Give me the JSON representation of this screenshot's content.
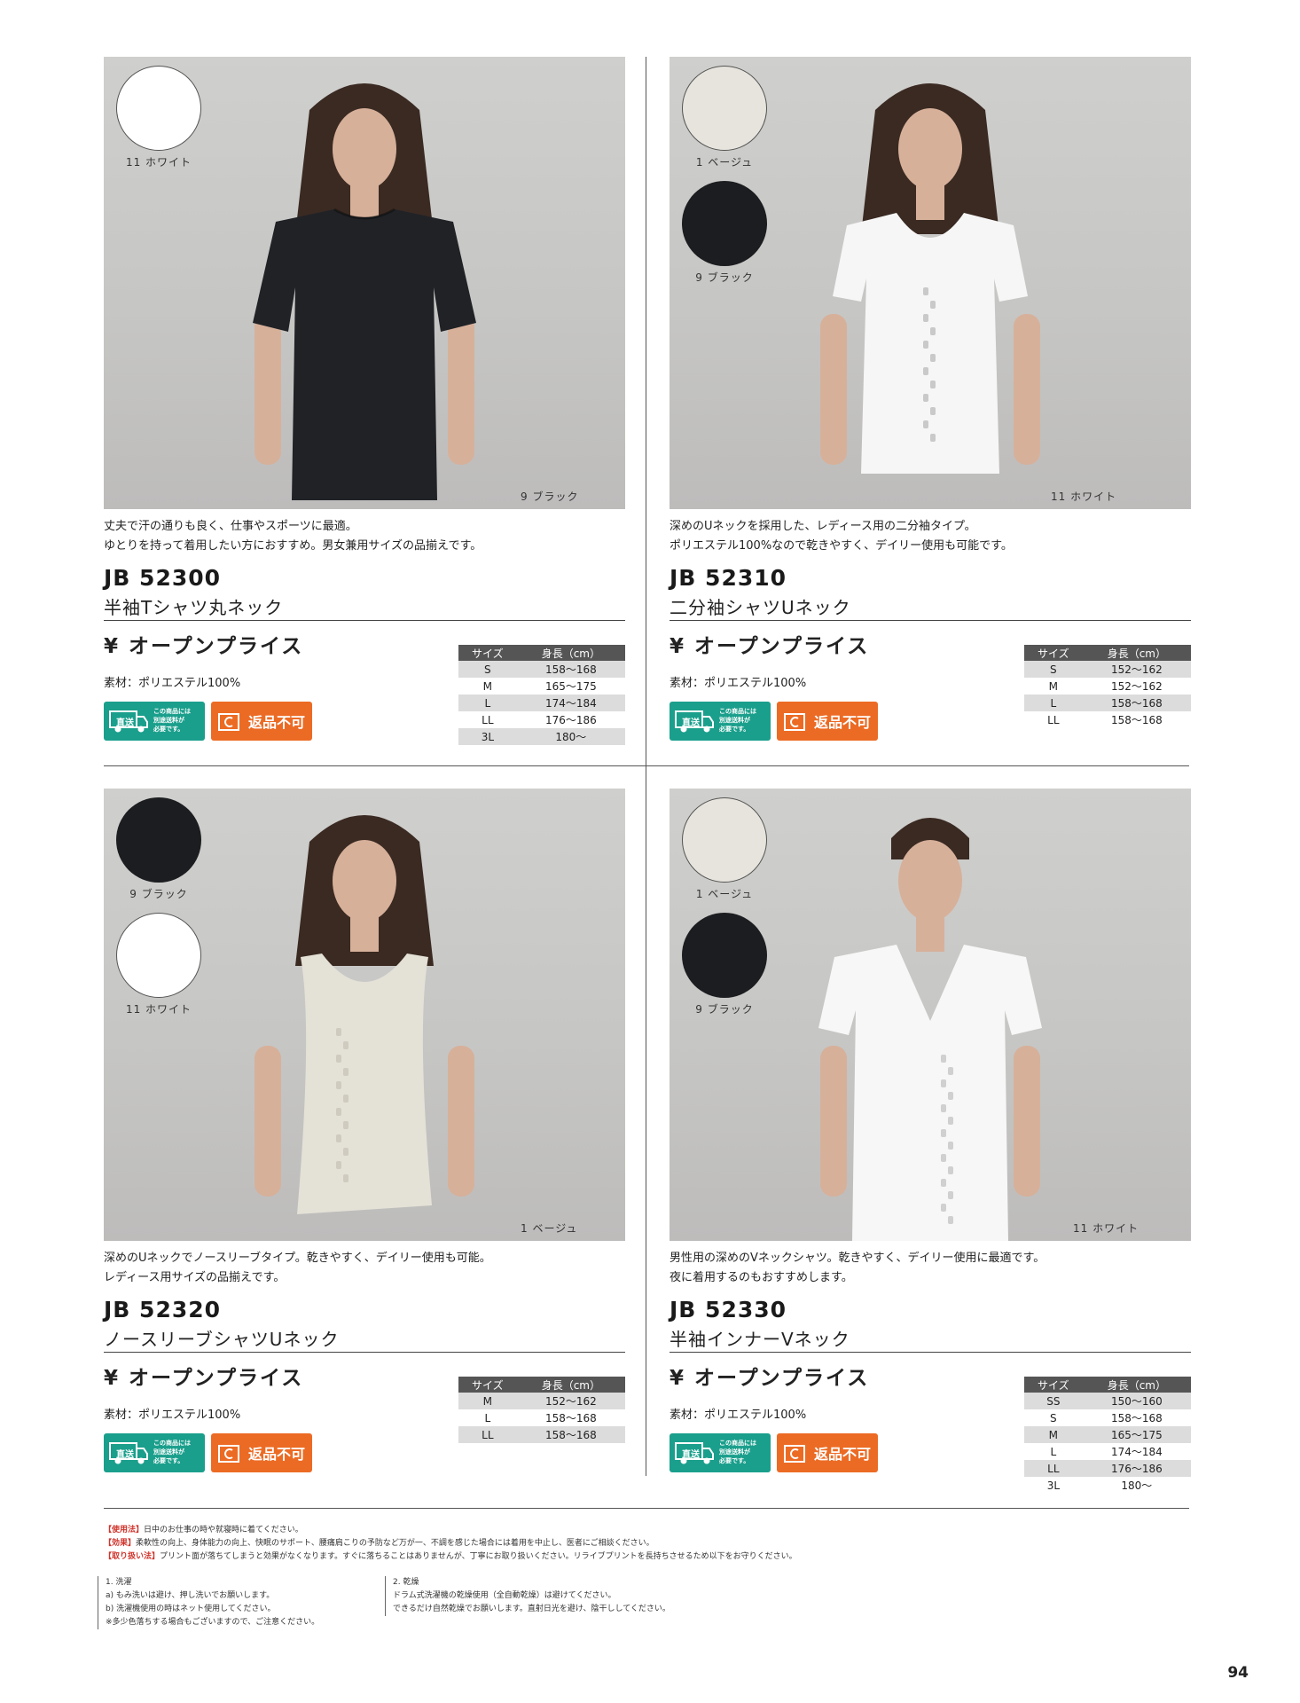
{
  "products": [
    {
      "photo_caption": "9 ブラック",
      "swatches": [
        {
          "label": "11 ホワイト",
          "color": "white"
        }
      ],
      "garment_color": "#202226",
      "garment_style": "tee",
      "desc": [
        "丈夫で汗の通りも良く、仕事やスポーツに最適。",
        "ゆとりを持って着用したい方におすすめ。男女兼用サイズの品揃えです。"
      ],
      "code": "JB 52300",
      "name": "半袖Tシャツ丸ネック",
      "price": "¥ オープンプライス",
      "material": "素材：ポリエステル100%",
      "size_header": [
        "サイズ",
        "身長（cm）"
      ],
      "sizes": [
        [
          "S",
          "158〜168"
        ],
        [
          "M",
          "165〜175"
        ],
        [
          "L",
          "174〜184"
        ],
        [
          "LL",
          "176〜186"
        ],
        [
          "3L",
          "180〜"
        ]
      ]
    },
    {
      "photo_caption": "11 ホワイト",
      "swatches": [
        {
          "label": "1 ベージュ",
          "color": "beige"
        },
        {
          "label": "9 ブラック",
          "color": "black"
        }
      ],
      "garment_color": "#f6f6f6",
      "garment_style": "ladies",
      "desc": [
        "深めのUネックを採用した、レディース用の二分袖タイプ。",
        "ポリエステル100%なので乾きやすく、デイリー使用も可能です。"
      ],
      "code": "JB 52310",
      "name": "二分袖シャツUネック",
      "price": "¥ オープンプライス",
      "material": "素材：ポリエステル100%",
      "size_header": [
        "サイズ",
        "身長（cm）"
      ],
      "sizes": [
        [
          "S",
          "152〜162"
        ],
        [
          "M",
          "152〜162"
        ],
        [
          "L",
          "158〜168"
        ],
        [
          "LL",
          "158〜168"
        ]
      ]
    },
    {
      "photo_caption": "1 ベージュ",
      "swatches": [
        {
          "label": "9 ブラック",
          "color": "black"
        },
        {
          "label": "11 ホワイト",
          "color": "white"
        }
      ],
      "garment_color": "#e4e1d7",
      "garment_style": "tank",
      "desc": [
        "深めのUネックでノースリーブタイプ。乾きやすく、デイリー使用も可能。",
        "レディース用サイズの品揃えです。"
      ],
      "code": "JB 52320",
      "name": "ノースリーブシャツUネック",
      "price": "¥ オープンプライス",
      "material": "素材：ポリエステル100%",
      "size_header": [
        "サイズ",
        "身長（cm）"
      ],
      "sizes": [
        [
          "M",
          "152〜162"
        ],
        [
          "L",
          "158〜168"
        ],
        [
          "LL",
          "158〜168"
        ]
      ]
    },
    {
      "photo_caption": "11 ホワイト",
      "swatches": [
        {
          "label": "1 ベージュ",
          "color": "beige"
        },
        {
          "label": "9 ブラック",
          "color": "black"
        }
      ],
      "garment_color": "#f7f7f7",
      "garment_style": "vneck",
      "desc": [
        "男性用の深めのVネックシャツ。乾きやすく、デイリー使用に最適です。",
        "夜に着用するのもおすすめします。"
      ],
      "code": "JB 52330",
      "name": "半袖インナーVネック",
      "price": "¥ オープンプライス",
      "material": "素材：ポリエステル100%",
      "size_header": [
        "サイズ",
        "身長（cm）"
      ],
      "sizes": [
        [
          "SS",
          "150〜160"
        ],
        [
          "S",
          "158〜168"
        ],
        [
          "M",
          "165〜175"
        ],
        [
          "L",
          "174〜184"
        ],
        [
          "LL",
          "176〜186"
        ],
        [
          "3L",
          "180〜"
        ]
      ]
    }
  ],
  "badges": {
    "direct_label": "直送",
    "direct_note": [
      "この商品には",
      "別途送料が",
      "必要です。"
    ],
    "noreturn_label": "返品不可"
  },
  "notes": [
    {
      "tag": "【使用法】",
      "text": "日中のお仕事の時や就寝時に着てください。"
    },
    {
      "tag": "【効果】",
      "text": "柔軟性の向上、身体能力の向上、快眠のサポート、腰痛肩こりの予防など万が一、不調を感じた場合には着用を中止し、医者にご相談ください。"
    },
    {
      "tag": "【取り扱い法】",
      "text": "プリント面が落ちてしまうと効果がなくなります。すぐに落ちることはありませんが、丁寧にお取り扱いください。リライブプリントを長持ちさせるため以下をお守りください。"
    }
  ],
  "care_wash": [
    "1. 洗濯",
    "a) もみ洗いは避け、押し洗いでお願いします。",
    "b) 洗濯機使用の時はネット使用してください。",
    "※多少色落ちする場合もございますので、ご注意ください。"
  ],
  "care_dry": [
    "2. 乾燥",
    "ドラム式洗濯機の乾燥使用（全自動乾燥）は避けてください。",
    "できるだけ自然乾燥でお願いします。直射日光を避け、陰干ししてください。"
  ],
  "page_number": "94",
  "colors": {
    "teal": "#1a9f8c",
    "orange": "#ec6b24",
    "note_red": "#d0342c"
  }
}
